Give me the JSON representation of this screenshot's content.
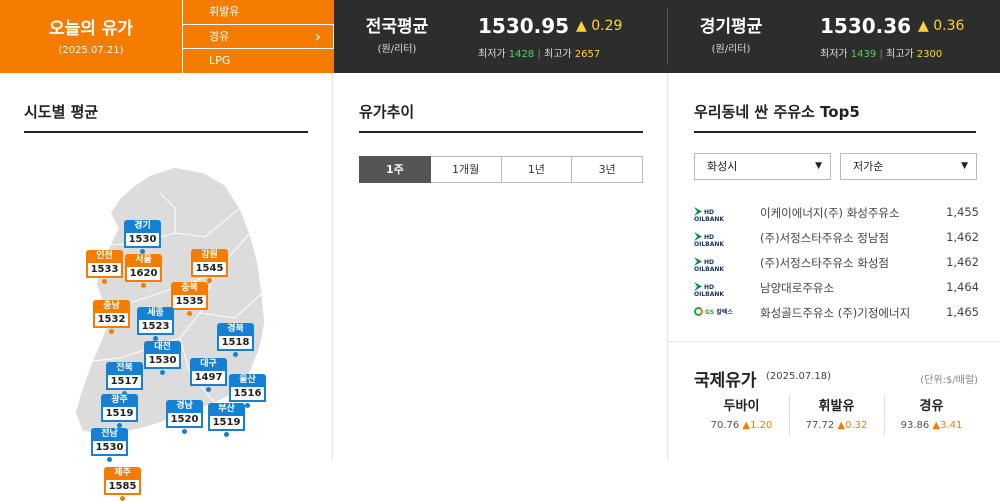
{
  "header": {
    "title": "오늘의 유가",
    "date": "(2025.07.21)",
    "fuel_menu": [
      "휘발유",
      "경유",
      "LPG"
    ],
    "selected_fuel": "경유",
    "national": {
      "name": "전국평균",
      "unit": "(원/리터)",
      "price": "1530.95",
      "change": "0.29",
      "min_label": "최저가",
      "min": "1428",
      "max_label": "최고가",
      "max": "2657"
    },
    "gyeonggi": {
      "name": "경기평균",
      "unit": "(원/리터)",
      "price": "1530.36",
      "change": "0.36",
      "min_label": "최저가",
      "min": "1439",
      "max_label": "최고가",
      "max": "2300"
    }
  },
  "regions": {
    "title": "시도별 평균",
    "items": [
      {
        "name": "경기",
        "value": "1530",
        "color": "blue"
      },
      {
        "name": "인천",
        "value": "1533",
        "color": "orange"
      },
      {
        "name": "서울",
        "value": "1620",
        "color": "orange"
      },
      {
        "name": "강원",
        "value": "1545",
        "color": "orange"
      },
      {
        "name": "충북",
        "value": "1535",
        "color": "orange"
      },
      {
        "name": "충남",
        "value": "1532",
        "color": "orange"
      },
      {
        "name": "세종",
        "value": "1523",
        "color": "blue"
      },
      {
        "name": "경북",
        "value": "1518",
        "color": "blue"
      },
      {
        "name": "대전",
        "value": "1530",
        "color": "blue"
      },
      {
        "name": "전북",
        "value": "1517",
        "color": "blue"
      },
      {
        "name": "대구",
        "value": "1497",
        "color": "blue"
      },
      {
        "name": "울산",
        "value": "1516",
        "color": "blue"
      },
      {
        "name": "광주",
        "value": "1519",
        "color": "blue"
      },
      {
        "name": "경남",
        "value": "1520",
        "color": "blue"
      },
      {
        "name": "부산",
        "value": "1519",
        "color": "blue"
      },
      {
        "name": "전남",
        "value": "1530",
        "color": "blue"
      },
      {
        "name": "제주",
        "value": "1585",
        "color": "orange"
      }
    ]
  },
  "trend": {
    "title": "유가추이",
    "tabs": [
      "1주",
      "1개월",
      "1년",
      "3년"
    ],
    "active_tab": "1주"
  },
  "top5": {
    "title": "우리동네 싼 주유소 Top5",
    "region_select": "화성시",
    "sort_select": "저가순",
    "stations": [
      {
        "brand": "HD HYUNDAI OILBANK",
        "name": "이케이에너지(주) 화성주유소",
        "price": "1,455"
      },
      {
        "brand": "HD HYUNDAI OILBANK",
        "name": "(주)서정스타주유소 정남점",
        "price": "1,462"
      },
      {
        "brand": "HD HYUNDAI OILBANK",
        "name": "(주)서정스타주유소 화성점",
        "price": "1,462"
      },
      {
        "brand": "HD HYUNDAI OILBANK",
        "name": "남양대로주유소",
        "price": "1,464"
      },
      {
        "brand": "GS칼텍스",
        "name": "화성골드주유소 (주)기정에너지",
        "price": "1,465"
      }
    ]
  },
  "international": {
    "title": "국제유가",
    "date": "(2025.07.18)",
    "unit": "(단위:$/배럴)",
    "items": [
      {
        "name": "두바이",
        "value": "70.76",
        "change": "1.20"
      },
      {
        "name": "휘발유",
        "value": "77.72",
        "change": "0.32"
      },
      {
        "name": "경유",
        "value": "93.86",
        "change": "3.41"
      }
    ]
  },
  "colors": {
    "orange": "#f57c00",
    "blue": "#1680d4",
    "dark": "#2d2d2d"
  }
}
